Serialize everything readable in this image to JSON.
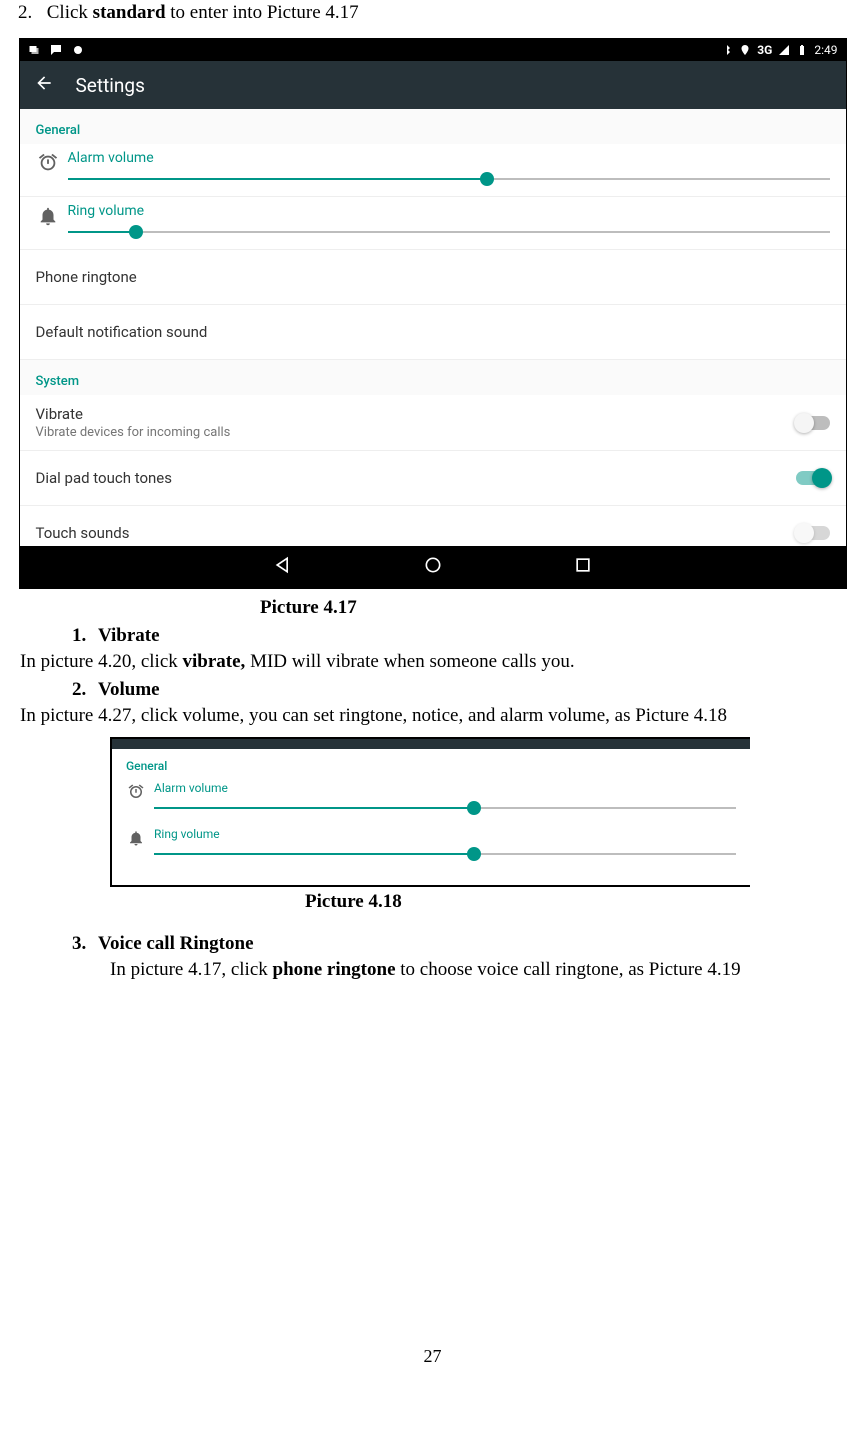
{
  "doc": {
    "instruction_num": "2.",
    "instruction_pre": "Click ",
    "instruction_bold": "standard",
    "instruction_post": " to enter into Picture 4.17",
    "caption1": "Picture 4.17",
    "item1_num": "1.",
    "item1_title": "Vibrate",
    "item1_body_pre": "In picture 4.20, click ",
    "item1_body_bold": "vibrate,",
    "item1_body_post": " MID will vibrate when someone calls you.",
    "item2_num": "2.",
    "item2_title": "Volume",
    "item2_body": "In picture 4.27, click volume, you can set ringtone, notice, and alarm volume, as Picture 4.18",
    "caption2": "Picture 4.18",
    "item3_num": "3.",
    "item3_title": "Voice call Ringtone",
    "item3_body_pre": "In picture 4.17, click ",
    "item3_body_bold": "phone ringtone",
    "item3_body_post": " to choose voice call ringtone, as Picture 4.19",
    "page_number": "27"
  },
  "screenshot1": {
    "status_right": "3G",
    "status_time": "2:49",
    "app_title": "Settings",
    "section_general": "General",
    "alarm_label": "Alarm volume",
    "alarm_pct": 55,
    "ring_label": "Ring volume",
    "ring_pct": 9,
    "phone_ringtone": "Phone ringtone",
    "default_notif": "Default notification sound",
    "section_system": "System",
    "vibrate_title": "Vibrate",
    "vibrate_sub": "Vibrate devices for incoming calls",
    "dialpad": "Dial pad touch tones",
    "touch_sounds": "Touch sounds"
  },
  "screenshot2": {
    "section_general": "General",
    "alarm_label": "Alarm volume",
    "alarm_pct": 55,
    "ring_label": "Ring volume",
    "ring_pct": 55
  }
}
